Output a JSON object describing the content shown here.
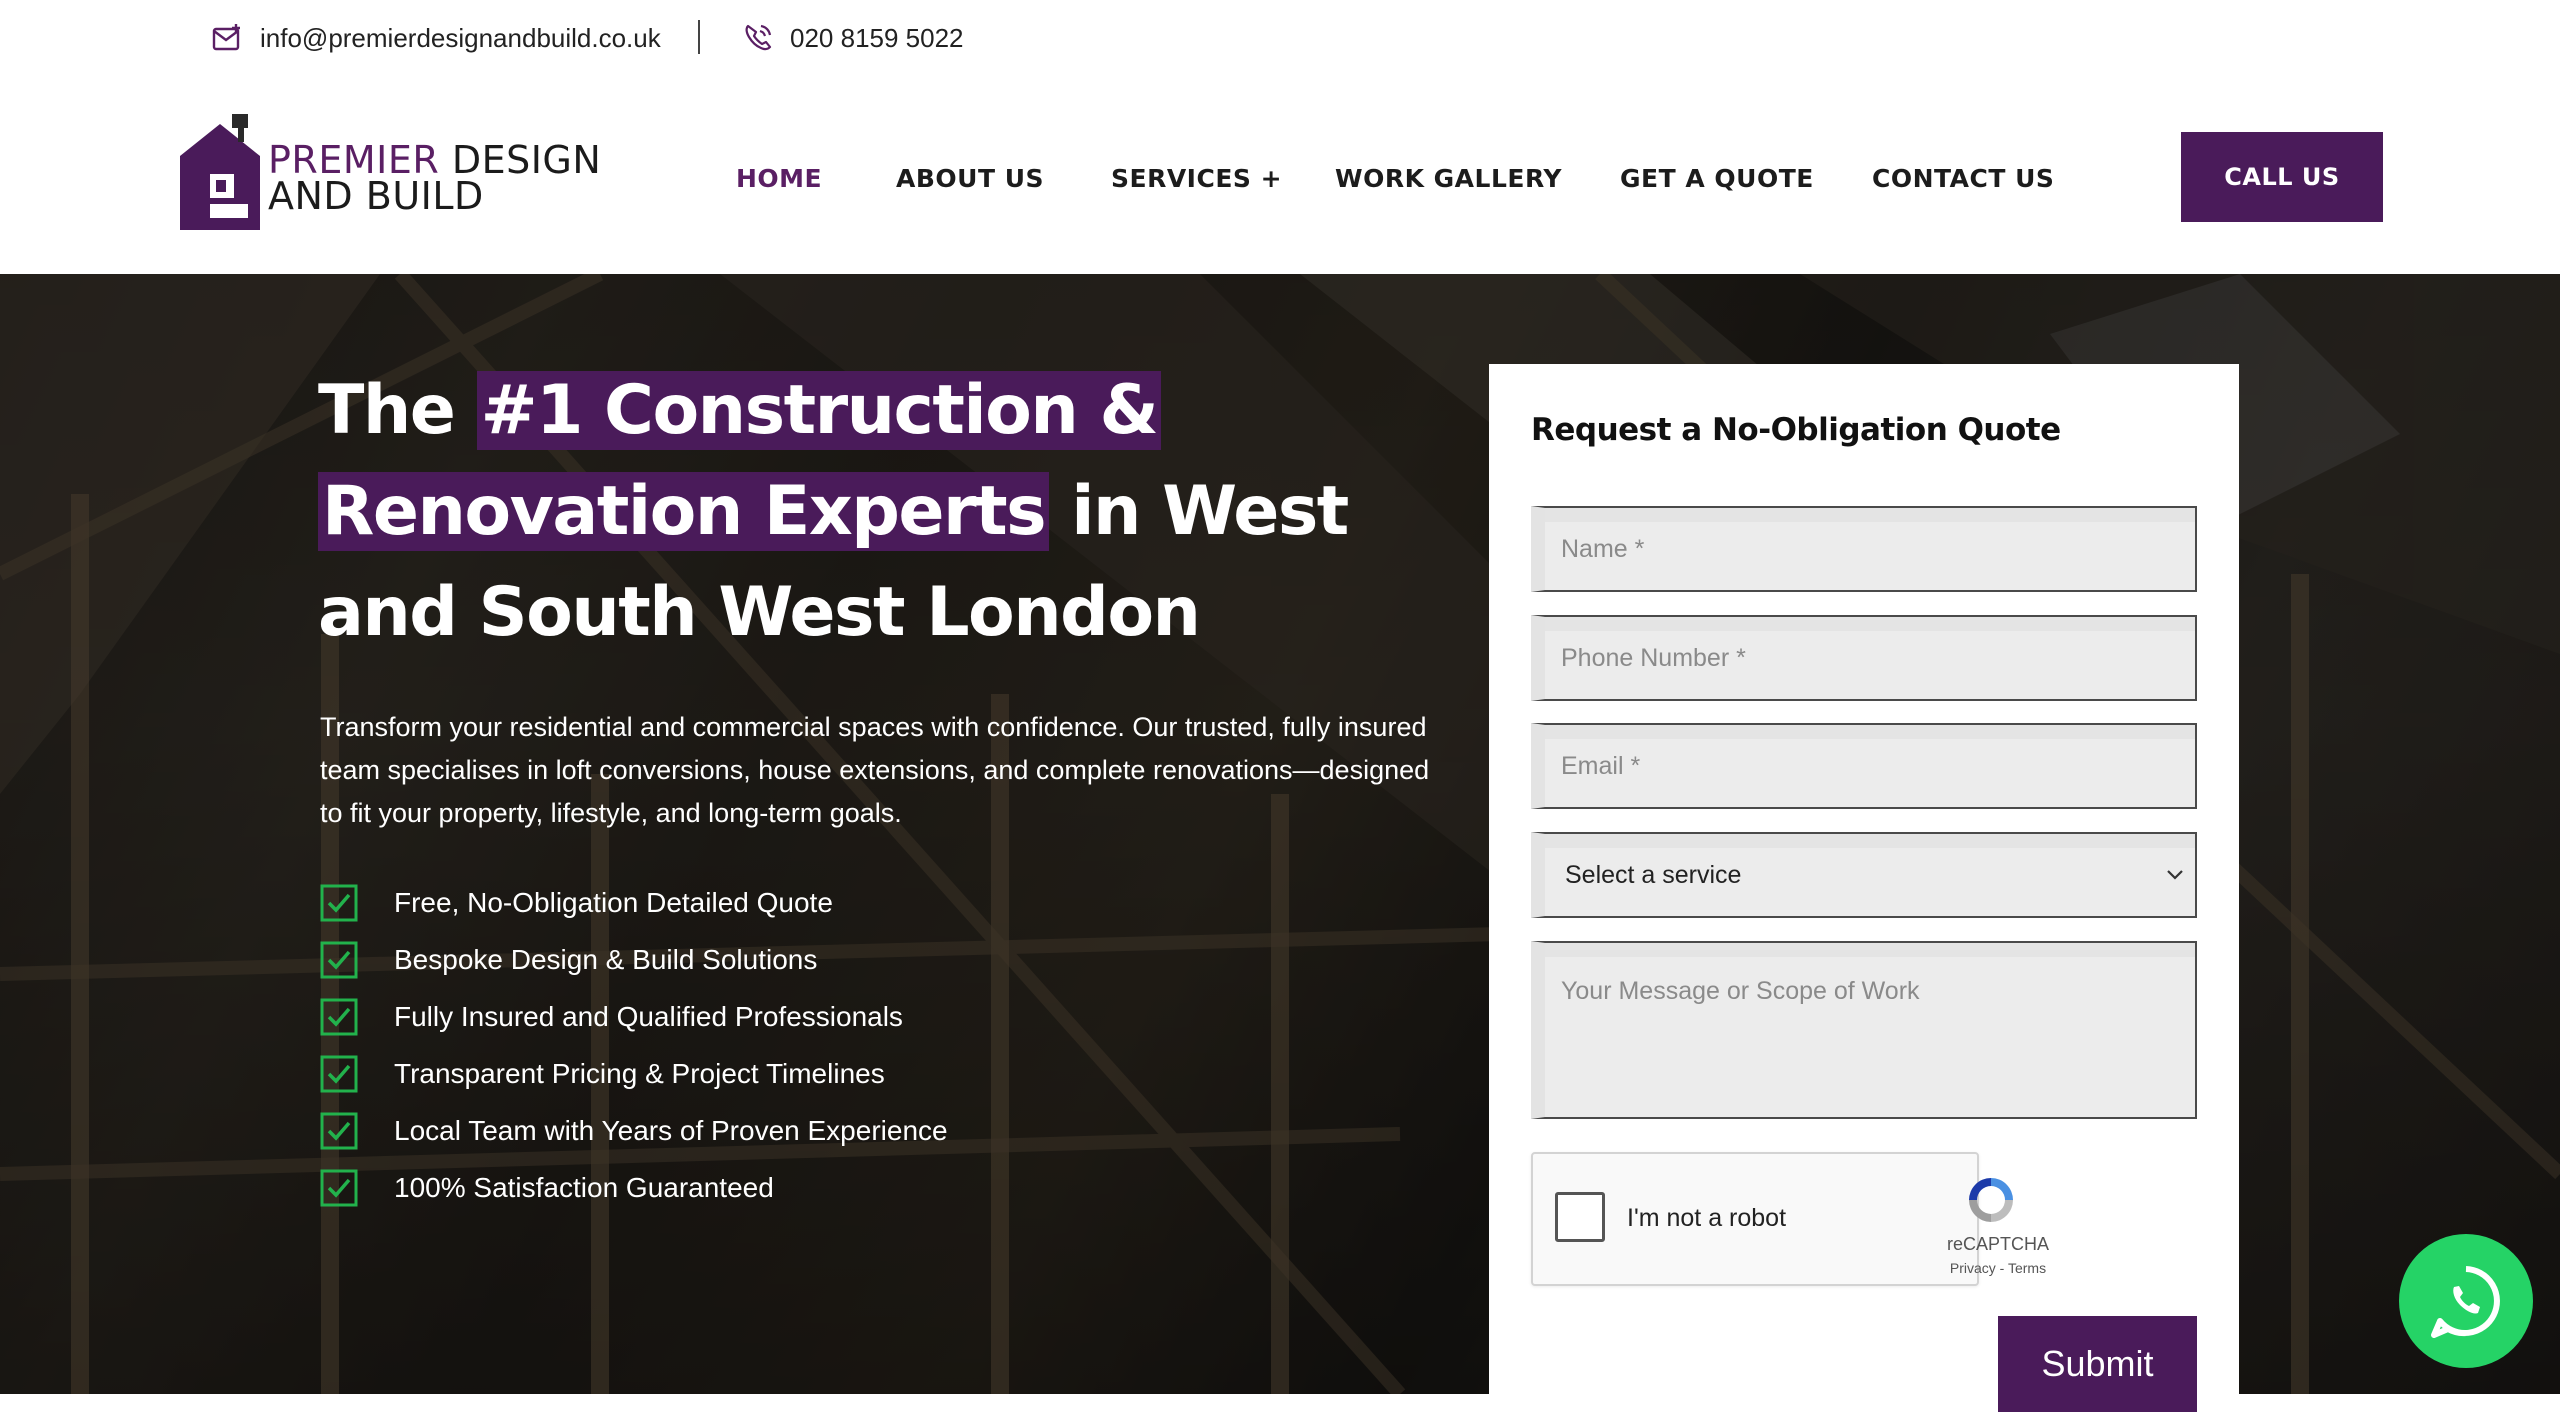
{
  "topbar": {
    "email": "info@premierdesignandbuild.co.uk",
    "phone": "020 8159 5022"
  },
  "logo": {
    "line1_accent": "PREMIER",
    "line1_rest": " DESIGN",
    "line2": "AND BUILD"
  },
  "nav": {
    "items": [
      {
        "label": "HOME",
        "active": true
      },
      {
        "label": "ABOUT US"
      },
      {
        "label": "SERVICES +"
      },
      {
        "label": "WORK GALLERY"
      },
      {
        "label": "GET A QUOTE"
      },
      {
        "label": "CONTACT US"
      }
    ],
    "cta": "CALL US"
  },
  "hero": {
    "title_part1": "The ",
    "title_highlight1": "#1 Construction &",
    "title_highlight2": "Renovation Experts",
    "title_part2": " in West and South West London",
    "description": "Transform your residential and commercial spaces with confidence. Our trusted, fully insured team specialises in loft conversions, house extensions, and complete renovations—designed to fit your property, lifestyle, and long-term goals.",
    "features": [
      "Free, No-Obligation Detailed Quote",
      "Bespoke Design & Build Solutions",
      "Fully Insured and Qualified Professionals",
      "Transparent Pricing & Project Timelines",
      "Local Team with Years of Proven Experience",
      "100% Satisfaction Guaranteed"
    ]
  },
  "form": {
    "title": "Request a No-Obligation Quote",
    "name_placeholder": "Name *",
    "phone_placeholder": "Phone Number *",
    "email_placeholder": "Email *",
    "service_selected": "Select a service",
    "message_placeholder": "Your Message or Scope of Work",
    "captcha_label": "I'm not a robot",
    "captcha_brand": "reCAPTCHA",
    "captcha_links": "Privacy - Terms",
    "submit": "Submit"
  },
  "colors": {
    "brand": "#4a1b5a",
    "check": "#22b24c",
    "whatsapp": "#25d366"
  }
}
